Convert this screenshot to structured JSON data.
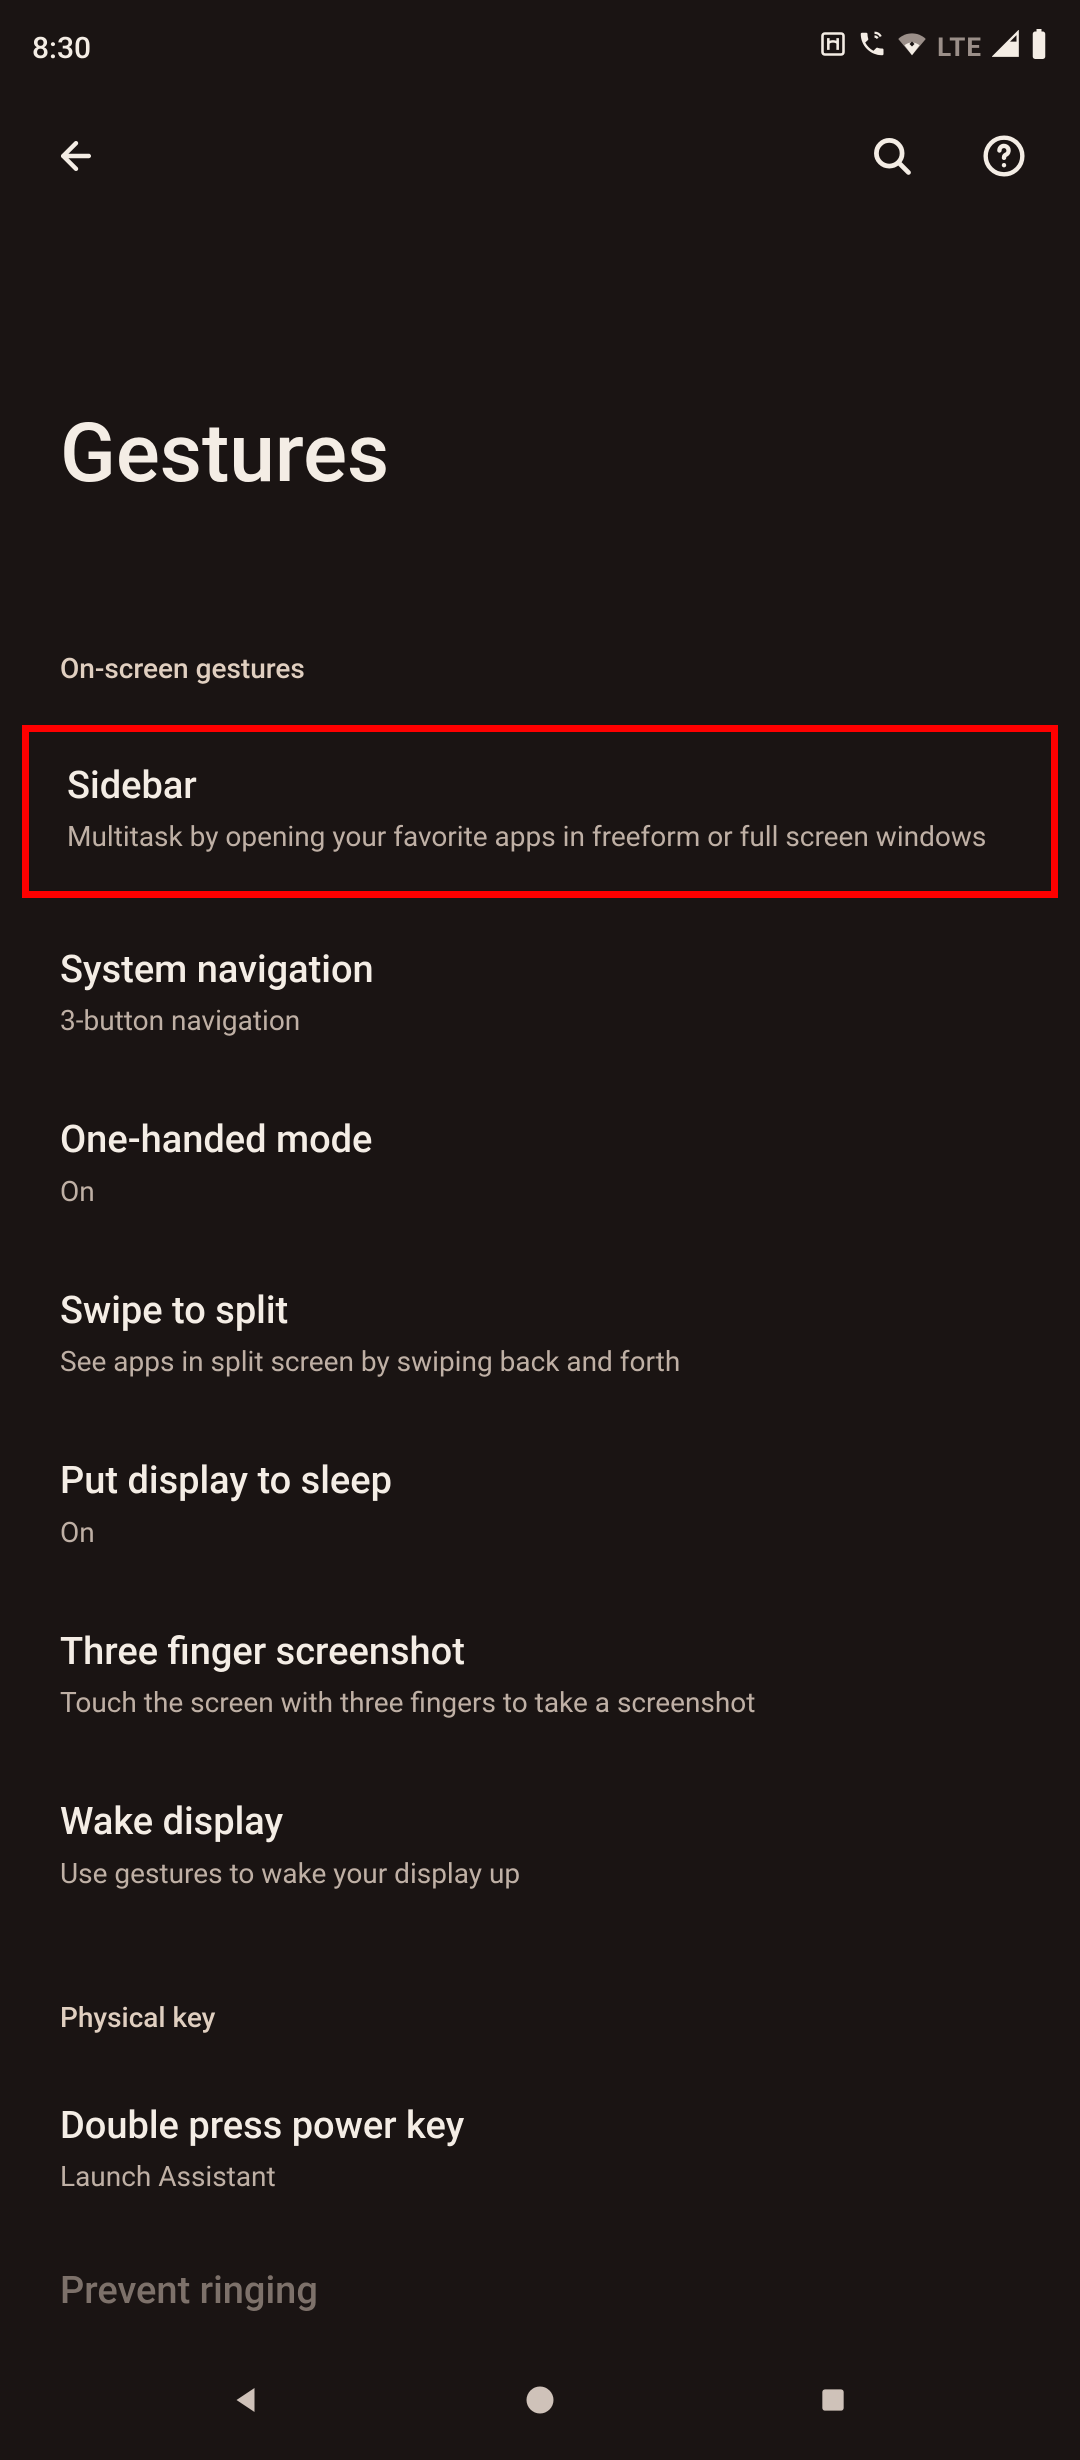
{
  "status": {
    "time": "8:30",
    "lte": "LTE"
  },
  "header": {
    "title": "Gestures"
  },
  "sections": [
    {
      "label": "On-screen gestures",
      "items": [
        {
          "title": "Sidebar",
          "subtitle": "Multitask by opening your favorite apps in freeform or full screen windows",
          "highlight": true
        },
        {
          "title": "System navigation",
          "subtitle": "3-button navigation"
        },
        {
          "title": "One-handed mode",
          "subtitle": "On"
        },
        {
          "title": "Swipe to split",
          "subtitle": "See apps in split screen by swiping back and forth"
        },
        {
          "title": "Put display to sleep",
          "subtitle": "On"
        },
        {
          "title": "Three finger screenshot",
          "subtitle": "Touch the screen with three fingers to take a screenshot"
        },
        {
          "title": "Wake display",
          "subtitle": "Use gestures to wake your display up"
        }
      ]
    },
    {
      "label": "Physical key",
      "items": [
        {
          "title": "Double press power key",
          "subtitle": "Launch Assistant"
        }
      ]
    }
  ],
  "cutoff_text": "Prevent ringing"
}
